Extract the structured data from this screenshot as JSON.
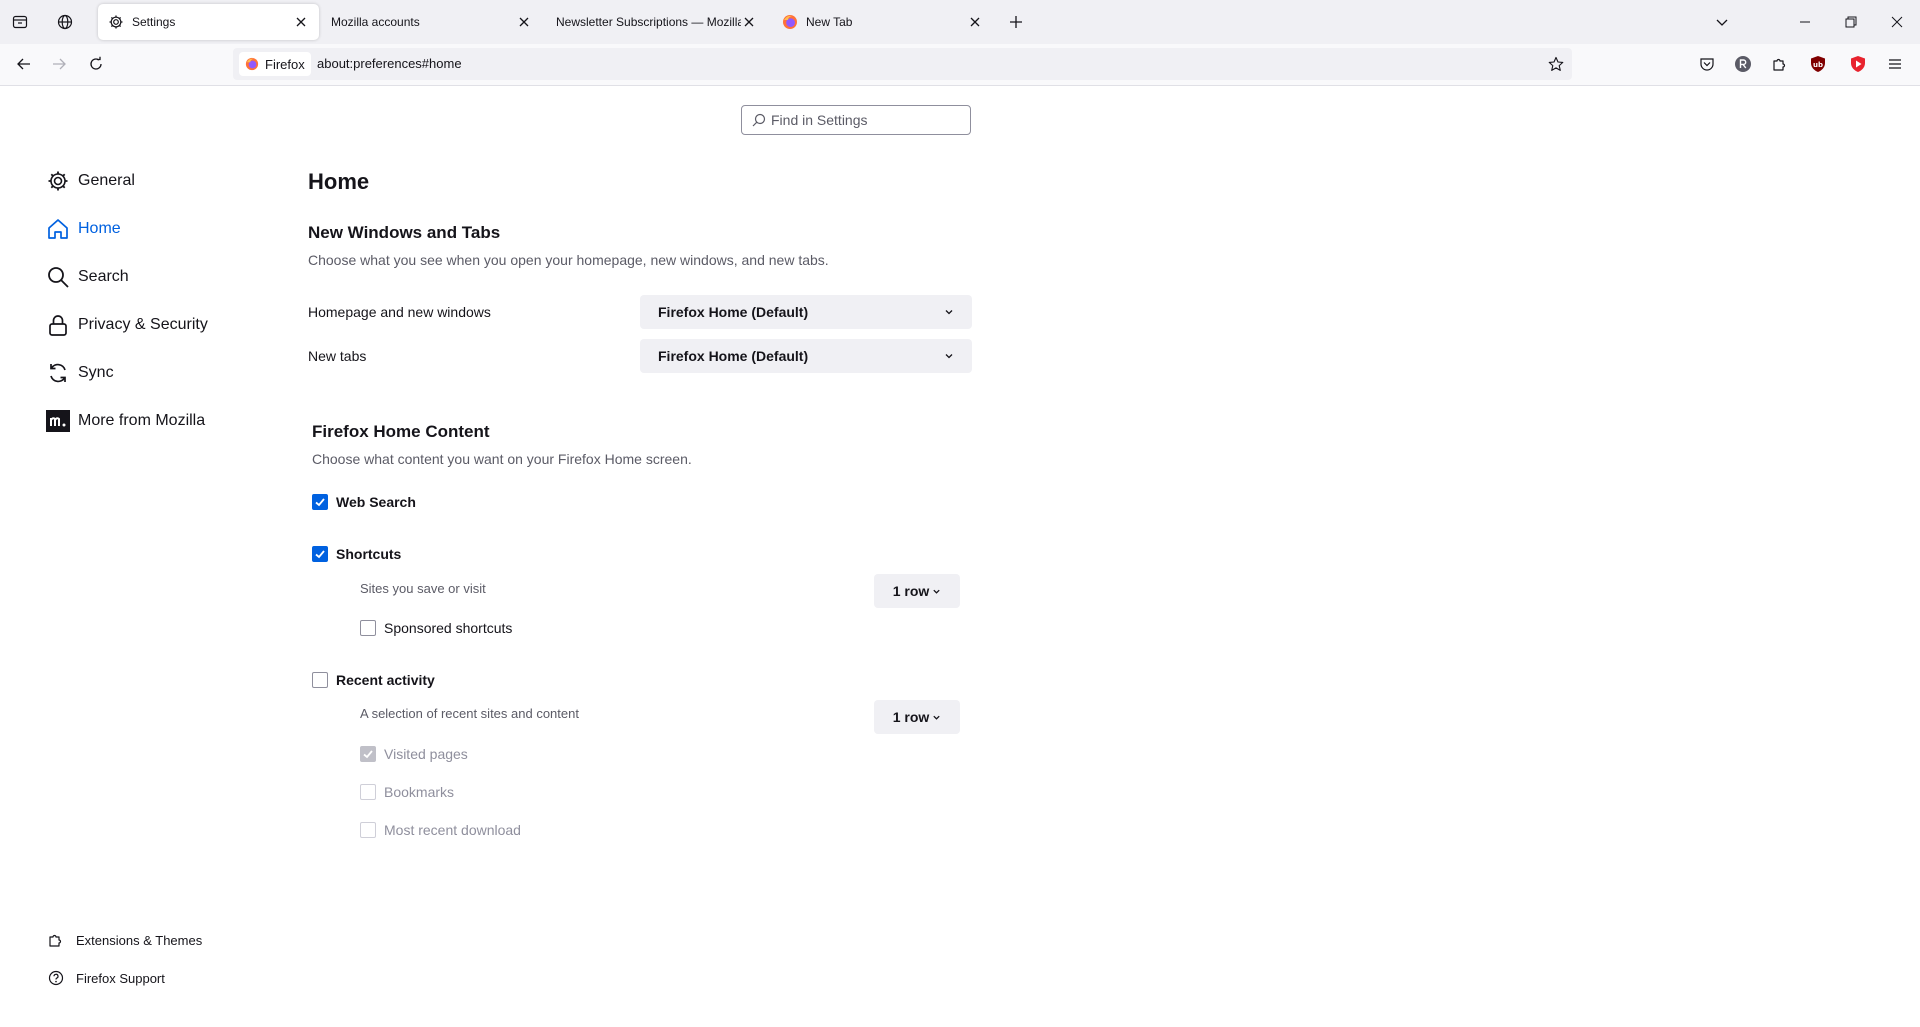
{
  "colors": {
    "accent": "#0061e0",
    "tabstrip": "#f0f0f4",
    "navbar": "#f9f9fb",
    "text": "#15141a",
    "muted": "#5b5b66"
  },
  "tabs": [
    {
      "title": "Settings",
      "icon": "gear-icon",
      "active": true
    },
    {
      "title": "Mozilla accounts",
      "icon": "",
      "active": false
    },
    {
      "title": "Newsletter Subscriptions — Mozilla",
      "icon": "",
      "active": false
    },
    {
      "title": "New Tab",
      "icon": "firefox-icon",
      "active": false
    }
  ],
  "urlbar": {
    "identity_label": "Firefox",
    "url": "about:preferences#home"
  },
  "search": {
    "placeholder": "Find in Settings"
  },
  "sidebar": {
    "categories": [
      {
        "label": "General",
        "icon": "gear-icon"
      },
      {
        "label": "Home",
        "icon": "home-icon",
        "selected": true
      },
      {
        "label": "Search",
        "icon": "search-icon"
      },
      {
        "label": "Privacy & Security",
        "icon": "lock-icon"
      },
      {
        "label": "Sync",
        "icon": "sync-icon"
      },
      {
        "label": "More from Mozilla",
        "icon": "mozilla-icon"
      }
    ],
    "footer": [
      {
        "label": "Extensions & Themes",
        "icon": "puzzle-icon"
      },
      {
        "label": "Firefox Support",
        "icon": "help-icon"
      }
    ]
  },
  "main": {
    "title": "Home",
    "new_windows": {
      "heading": "New Windows and Tabs",
      "description": "Choose what you see when you open your homepage, new windows, and new tabs.",
      "homepage_label": "Homepage and new windows",
      "homepage_value": "Firefox Home (Default)",
      "newtabs_label": "New tabs",
      "newtabs_value": "Firefox Home (Default)"
    },
    "home_content": {
      "heading": "Firefox Home Content",
      "description": "Choose what content you want on your Firefox Home screen.",
      "web_search": {
        "label": "Web Search",
        "checked": true
      },
      "shortcuts": {
        "label": "Shortcuts",
        "checked": true,
        "description": "Sites you save or visit",
        "rows": "1 row"
      },
      "sponsored_shortcuts": {
        "label": "Sponsored shortcuts",
        "checked": false
      },
      "recent_activity": {
        "label": "Recent activity",
        "checked": false,
        "description": "A selection of recent sites and content",
        "rows": "1 row"
      },
      "visited_pages": {
        "label": "Visited pages",
        "checked": true,
        "disabled": true
      },
      "bookmarks": {
        "label": "Bookmarks",
        "checked": false,
        "disabled": true
      },
      "most_recent_download": {
        "label": "Most recent download",
        "checked": false,
        "disabled": true
      }
    }
  }
}
